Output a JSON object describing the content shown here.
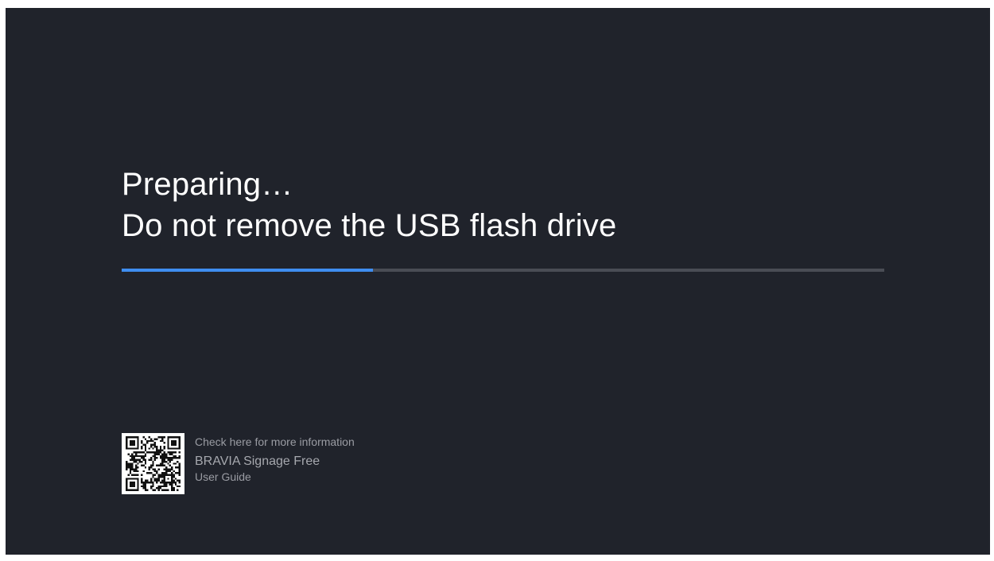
{
  "status": {
    "line1": "Preparing…",
    "line2": "Do not remove the USB flash drive"
  },
  "progress": {
    "fraction": 0.33,
    "fill_color": "#3f8ef0",
    "track_color": "#4a4d55"
  },
  "info": {
    "caption": "Check here for more information",
    "product": "BRAVIA Signage Free",
    "doc": "User Guide",
    "qr_icon": "qr-code-icon"
  },
  "colors": {
    "background": "#20232b",
    "text": "#ffffff"
  }
}
